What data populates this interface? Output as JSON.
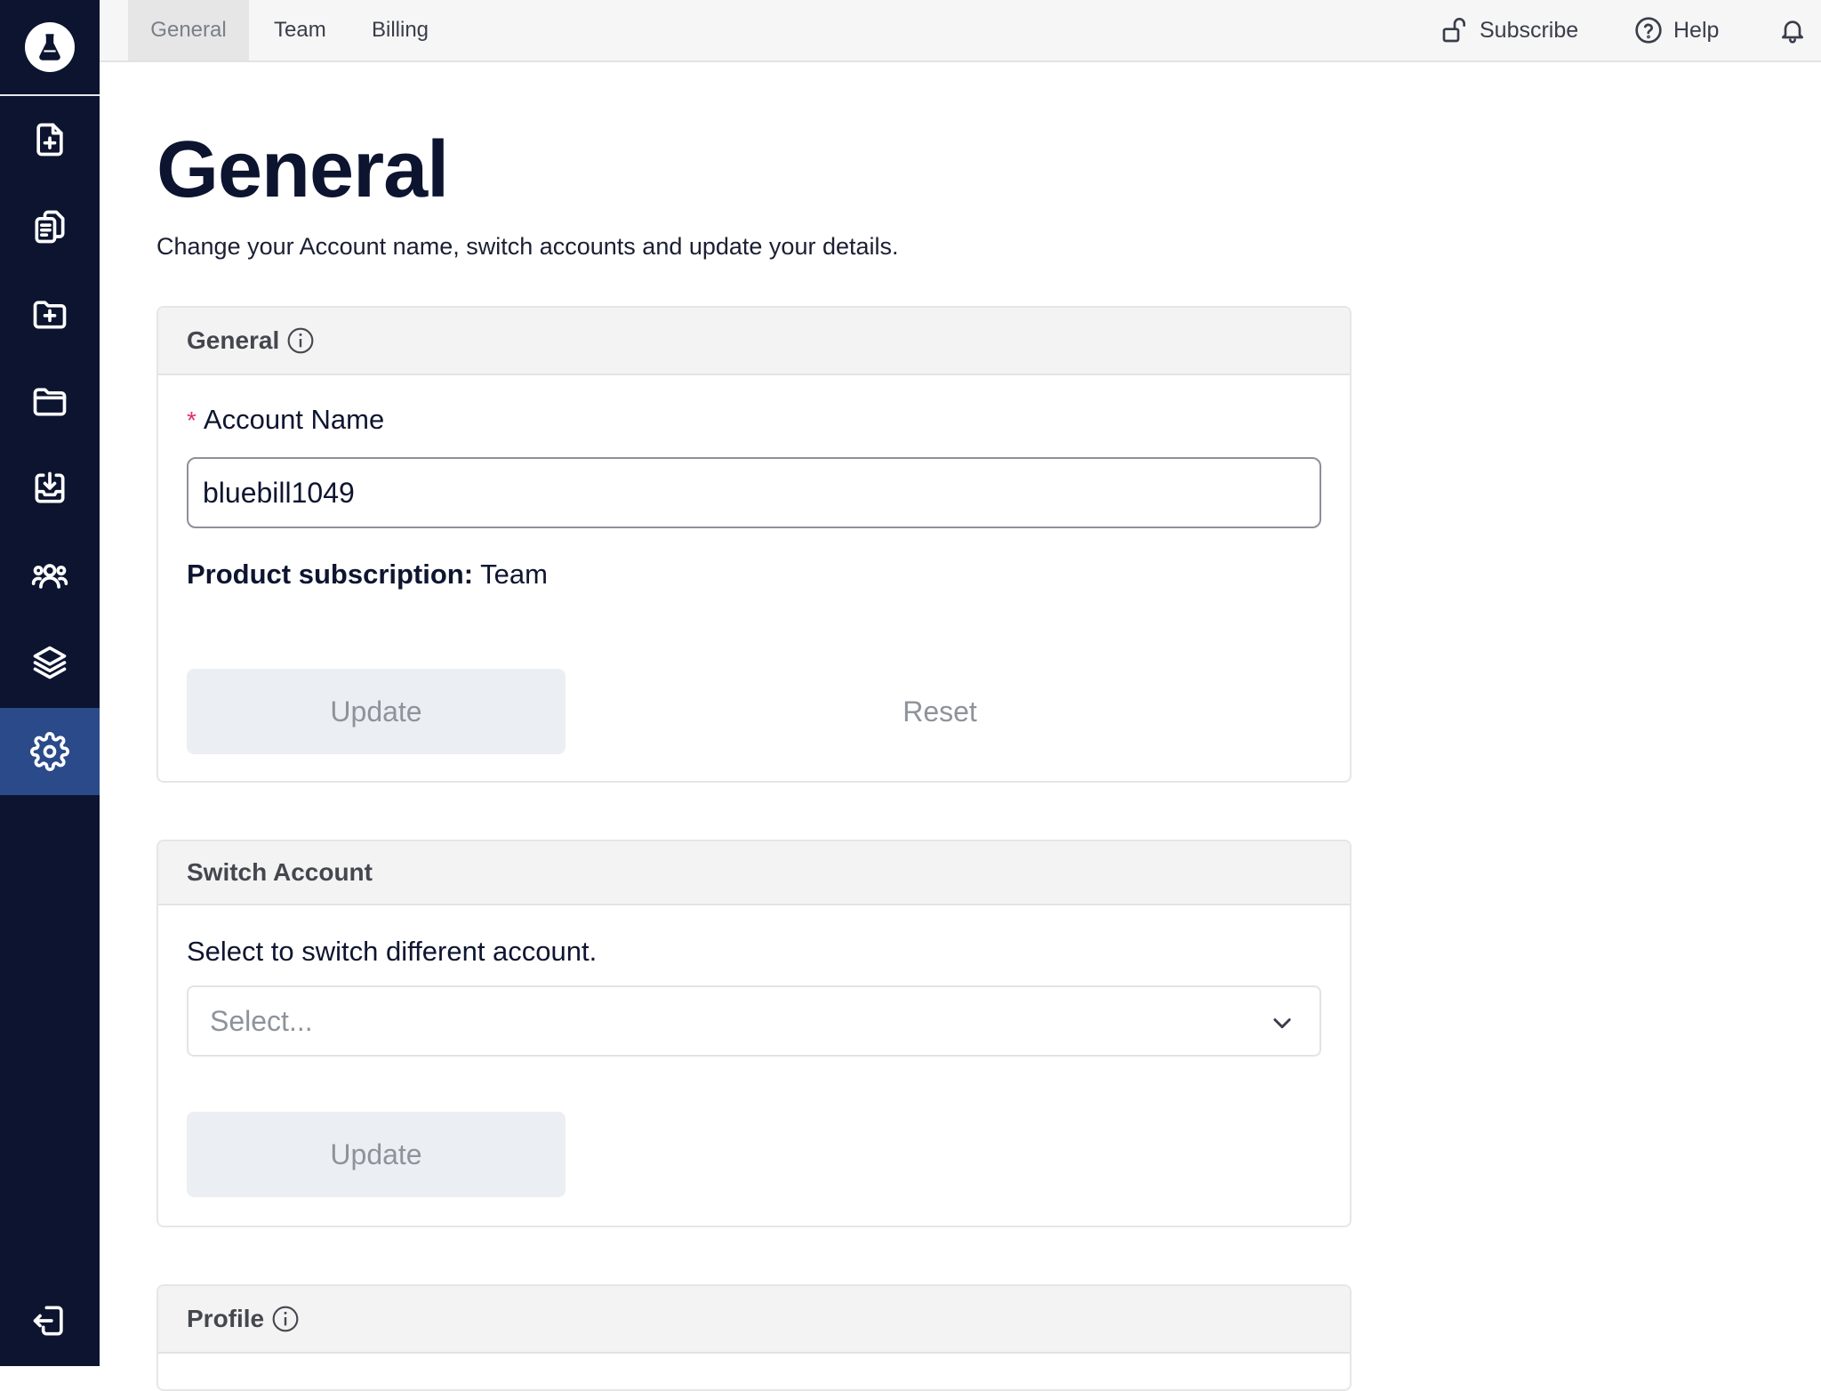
{
  "sidebar": {
    "items": [
      {
        "icon": "file-plus-icon"
      },
      {
        "icon": "clipboard-copy-icon"
      },
      {
        "icon": "folder-plus-icon"
      },
      {
        "icon": "folder-icon"
      },
      {
        "icon": "inbox-download-icon"
      },
      {
        "icon": "users-icon"
      },
      {
        "icon": "layers-icon"
      },
      {
        "icon": "gear-icon",
        "active": true
      }
    ],
    "bottom_icon": "logout-icon",
    "logo_icon": "flask-icon"
  },
  "topbar": {
    "tabs": [
      {
        "label": "General",
        "active": true
      },
      {
        "label": "Team"
      },
      {
        "label": "Billing"
      }
    ],
    "subscribe_label": "Subscribe",
    "help_label": "Help"
  },
  "page": {
    "title": "General",
    "subtitle": "Change your Account name, switch accounts and update your details."
  },
  "general_card": {
    "header": "General",
    "required_marker": "*",
    "account_name_label": "Account Name",
    "account_name_value": "bluebill1049",
    "subscription_label": "Product subscription:",
    "subscription_value": "Team",
    "update_label": "Update",
    "reset_label": "Reset"
  },
  "switch_card": {
    "header": "Switch Account",
    "label": "Select to switch different account.",
    "select_placeholder": "Select...",
    "update_label": "Update"
  },
  "profile_card": {
    "header": "Profile"
  },
  "colors": {
    "sidebar_bg": "#0c1430",
    "sidebar_active": "#2a4a8a",
    "required": "#e0306a"
  }
}
